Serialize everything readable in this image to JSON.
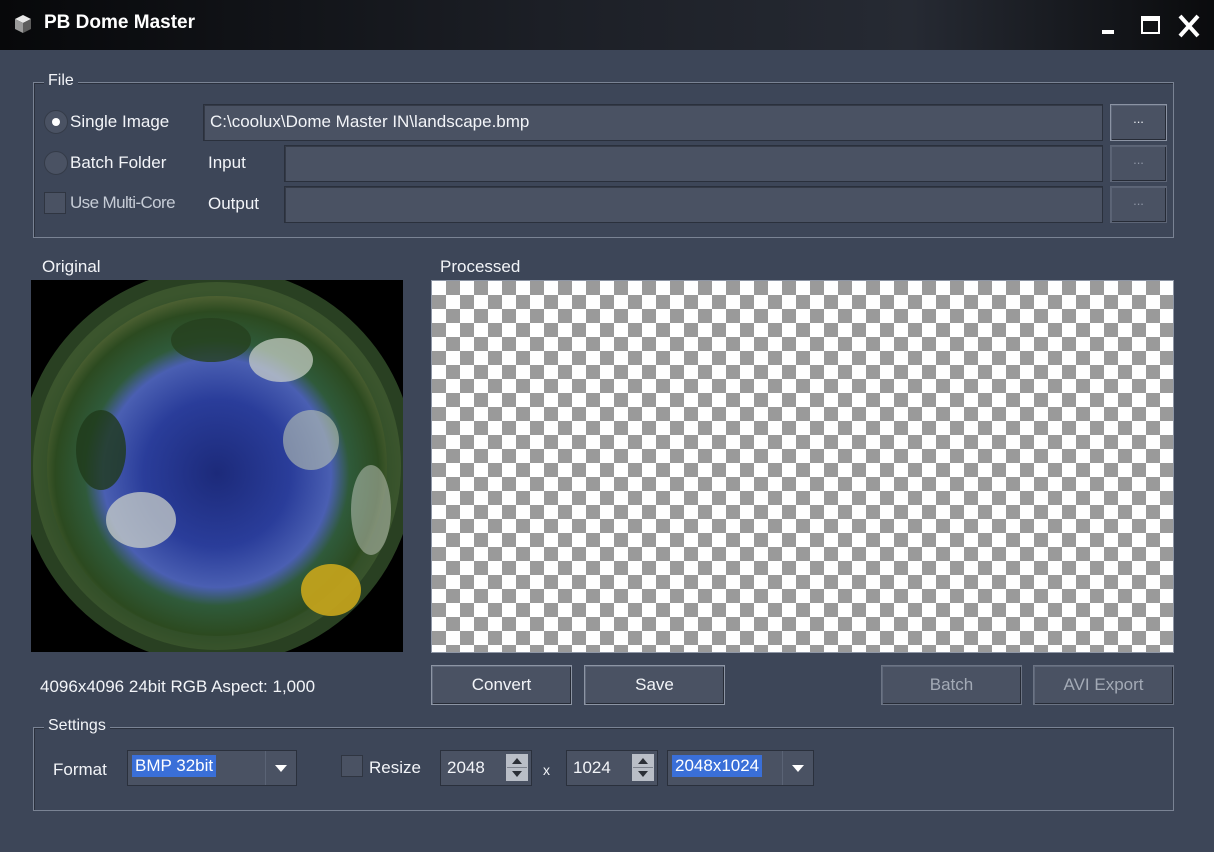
{
  "window": {
    "title": "PB Dome Master",
    "controls": [
      "minimize-icon",
      "maximize-icon",
      "close-icon"
    ]
  },
  "file_group": {
    "legend": "File",
    "single_image_label": "Single Image",
    "single_image_selected": true,
    "single_image_path": "C:\\coolux\\Dome Master IN\\landscape.bmp",
    "batch_folder_label": "Batch Folder",
    "input_label": "Input",
    "input_value": "",
    "multicore_label": "Use Multi-Core",
    "output_label": "Output",
    "output_value": "",
    "browse_label": "..."
  },
  "preview": {
    "original_label": "Original",
    "processed_label": "Processed",
    "image_info": "4096x4096 24bit RGB Aspect: 1,000"
  },
  "actions": {
    "convert": "Convert",
    "save": "Save",
    "batch": "Batch",
    "avi_export": "AVI Export"
  },
  "settings": {
    "legend": "Settings",
    "format_label": "Format",
    "format_value": "BMP 32bit",
    "resize_label": "Resize",
    "resize_checked": false,
    "width_value": "2048",
    "times": "x",
    "height_value": "1024",
    "preset_value": "2048x1024"
  },
  "colors": {
    "background": "#3d4658",
    "field": "#4a5263",
    "selection": "#3a6fd8"
  }
}
